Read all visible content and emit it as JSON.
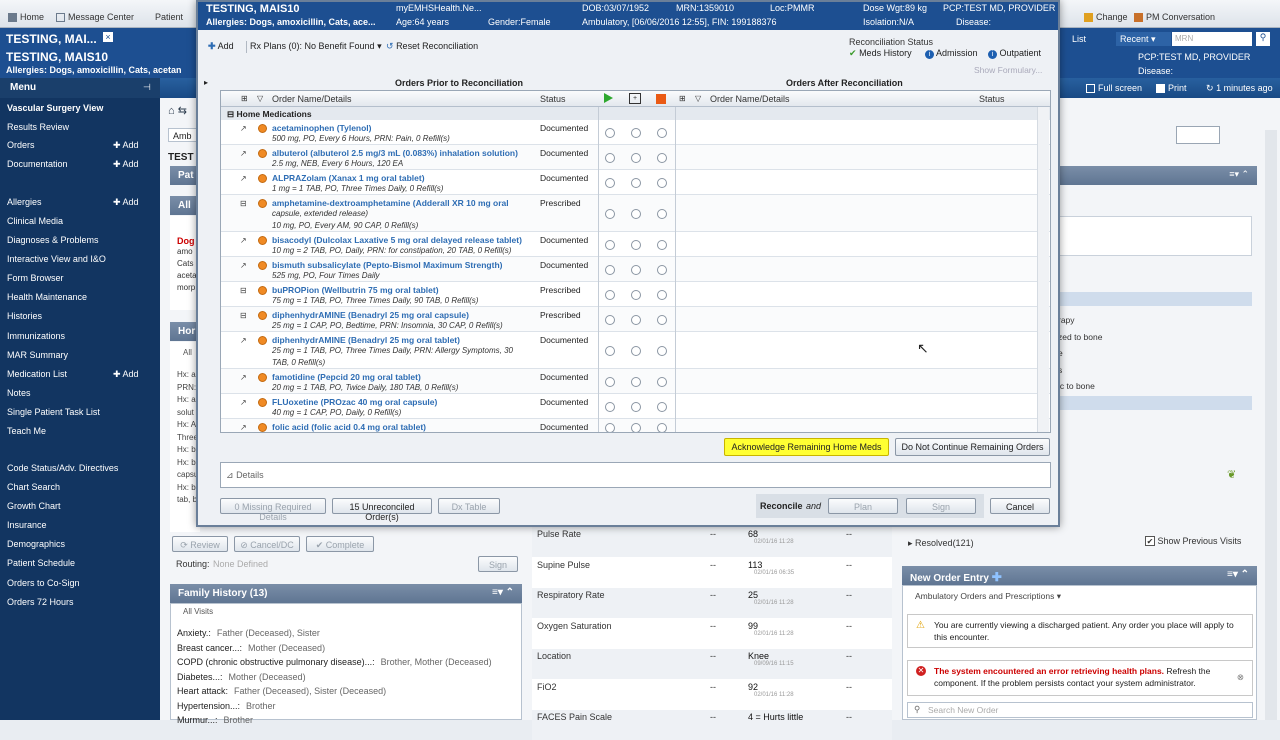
{
  "top_toolbar": {
    "home": "Home",
    "message_center": "Message Center",
    "patient": "Patient",
    "change": "Change",
    "pm_conversation": "PM Conversation",
    "list": "List",
    "recent": "Recent",
    "mrn_placeholder": "MRN"
  },
  "banner": {
    "name": "TESTING, MAI...",
    "name_full": "TESTING, MAIS10",
    "allergies": "Allergies: Dogs, amoxicillin, Cats, acetan",
    "pcp": "PCP:TEST MD, PROVIDER",
    "disease": "Disease:"
  },
  "strip": {
    "full_screen": "Full screen",
    "print": "Print",
    "updated": "1 minutes ago"
  },
  "menu": {
    "title": "Menu",
    "items": [
      {
        "label": "Vascular Surgery View",
        "add": ""
      },
      {
        "label": "Results Review",
        "add": ""
      },
      {
        "label": "Orders",
        "add": "Add"
      },
      {
        "label": "Documentation",
        "add": "Add"
      },
      {
        "label": "Allergies",
        "add": "Add"
      },
      {
        "label": "Clinical Media",
        "add": ""
      },
      {
        "label": "Diagnoses & Problems",
        "add": ""
      },
      {
        "label": "Interactive View and I&O",
        "add": ""
      },
      {
        "label": "Form Browser",
        "add": ""
      },
      {
        "label": "Health Maintenance",
        "add": ""
      },
      {
        "label": "Histories",
        "add": ""
      },
      {
        "label": "Immunizations",
        "add": ""
      },
      {
        "label": "MAR Summary",
        "add": ""
      },
      {
        "label": "Medication List",
        "add": "Add"
      },
      {
        "label": "Notes",
        "add": ""
      },
      {
        "label": "Single Patient Task List",
        "add": ""
      },
      {
        "label": "Teach Me",
        "add": ""
      },
      {
        "label": "Code Status/Adv. Directives",
        "add": ""
      },
      {
        "label": "Chart Search",
        "add": ""
      },
      {
        "label": "Growth Chart",
        "add": ""
      },
      {
        "label": "Insurance",
        "add": ""
      },
      {
        "label": "Demographics",
        "add": ""
      },
      {
        "label": "Patient Schedule",
        "add": ""
      },
      {
        "label": "Orders to Co-Sign",
        "add": ""
      },
      {
        "label": "Orders 72 Hours",
        "add": ""
      }
    ]
  },
  "background": {
    "amb": "Amb",
    "test": "TEST",
    "pat": "Pat",
    "all": "All",
    "allergy_dog": "Dog",
    "allergy_lines": [
      "amo",
      "Cats",
      "aceta",
      "morp"
    ],
    "hor": "Hor",
    "all2": "All",
    "left_frag": [
      "Hx: a",
      "PRN:",
      "Hx: a",
      "solut",
      "Hx: A",
      "Three",
      "Hx: b",
      "Hx: b",
      "capsu",
      "Hx: b",
      "tab, b"
    ],
    "review": "Review",
    "cancel_dc": "Cancel/DC",
    "complete": "Complete",
    "routing": "Routing:",
    "routing_val": "None Defined",
    "sign": "Sign",
    "family_history": {
      "title": "Family History",
      "count": "(13)",
      "all_visits": "All Visits",
      "rows": [
        {
          "cond": "Anxiety.:",
          "who": "Father (Deceased), Sister"
        },
        {
          "cond": "Breast cancer...:",
          "who": "Mother (Deceased)"
        },
        {
          "cond": "COPD (chronic obstructive pulmonary disease)...:",
          "who": "Brother, Mother (Deceased)"
        },
        {
          "cond": "Diabetes...:",
          "who": "Mother (Deceased)"
        },
        {
          "cond": "Heart attack:",
          "who": "Father (Deceased), Sister (Deceased)"
        },
        {
          "cond": "Hypertension...:",
          "who": "Brother"
        },
        {
          "cond": "Murmur...:",
          "who": "Brother"
        }
      ]
    },
    "vitals": [
      {
        "label": "Pulse Rate",
        "dash": "--",
        "val": "68",
        "date": "02/01/16 11:28",
        "dash2": "--"
      },
      {
        "label": "Supine Pulse",
        "dash": "--",
        "val": "113",
        "date": "02/01/16 06:35",
        "dash2": "--"
      },
      {
        "label": "Respiratory Rate",
        "dash": "--",
        "val": "25",
        "date": "02/01/16 11:28",
        "dash2": "--"
      },
      {
        "label": "Oxygen Saturation",
        "dash": "--",
        "val": "99",
        "date": "02/01/16 11:28",
        "dash2": "--"
      },
      {
        "label": "Location",
        "dash": "--",
        "val": "Knee",
        "date": "09/09/16 11:15",
        "dash2": "--"
      },
      {
        "label": "FiO2",
        "dash": "--",
        "val": "92",
        "date": "02/01/16 11:28",
        "dash2": "--"
      },
      {
        "label": "FACES Pain Scale",
        "dash": "--",
        "val": "4 = Hurts little",
        "date": "",
        "dash2": "--"
      }
    ],
    "right_frag": [
      "rapy",
      "zed to bone",
      "e",
      "s",
      "ic to bone"
    ],
    "resolved": "Resolved",
    "resolved_count": "(121)",
    "show_prev": "Show Previous Visits",
    "new_order": {
      "title": "New Order Entry",
      "sub": "Ambulatory Orders and Prescriptions",
      "warn": "You are currently viewing a discharged patient. Any order you place will apply to this encounter.",
      "err_bold": "The system encountered an error retrieving health plans.",
      "err_rest": " Refresh the component. If the problem persists contact your system administrator.",
      "search_ph": "Search New Order"
    }
  },
  "modal": {
    "name": "TESTING, MAIS10",
    "org": "myEMHSHealth.Ne...",
    "dob": "DOB:03/07/1952",
    "mrn": "MRN:1359010",
    "loc": "Loc:PMMR",
    "dose_wgt": "Dose Wgt:89 kg",
    "pcp": "PCP:TEST MD, PROVIDER",
    "allergies": "Allergies: Dogs, amoxicillin, Cats, ace...",
    "age": "Age:64 years",
    "gender": "Gender:Female",
    "encounter": "Ambulatory, [06/06/2016 12:55], FIN: 199188376",
    "isolation": "Isolation:N/A",
    "disease": "Disease:",
    "add": "Add",
    "rx_plans": "Rx Plans (0): No Benefit Found",
    "reset": "Reset Reconciliation",
    "recon_status": "Reconciliation Status",
    "meds_history": "Meds History",
    "admission": "Admission",
    "outpatient": "Outpatient",
    "show_formulary": "Show Formulary...",
    "prior_title": "Orders Prior to Reconciliation",
    "after_title": "Orders After Reconciliation",
    "col_name": "Order Name/Details",
    "col_status": "Status",
    "col_name2": "Order Name/Details",
    "col_status2": "Status",
    "group": "Home Medications",
    "orders": [
      {
        "name": "acetaminophen (Tylenol)",
        "detail": "500 mg, PO, Every 6 Hours, PRN: Pain, 0 Refill(s)",
        "detail2": "",
        "status": "Documented",
        "rx": false
      },
      {
        "name": "albuterol (albuterol 2.5 mg/3 mL (0.083%) inhalation solution)",
        "detail": "2.5 mg, NEB, Every 6 Hours, 120 EA",
        "detail2": "",
        "status": "Documented",
        "rx": false
      },
      {
        "name": "ALPRAZolam (Xanax 1 mg oral tablet)",
        "detail": "1 mg = 1 TAB, PO, Three Times Daily, 0 Refill(s)",
        "detail2": "",
        "status": "Documented",
        "rx": false
      },
      {
        "name": "amphetamine-dextroamphetamine (Adderall XR 10 mg oral",
        "detail": "capsule, extended release)",
        "detail2": "10 mg, PO, Every AM, 90 CAP, 0 Refill(s)",
        "status": "Prescribed",
        "rx": true
      },
      {
        "name": "bisacodyl (Dulcolax Laxative 5 mg oral delayed release tablet)",
        "detail": "10 mg = 2 TAB, PO, Daily, PRN: for constipation, 20 TAB, 0 Refill(s)",
        "detail2": "",
        "status": "Documented",
        "rx": false
      },
      {
        "name": "bismuth subsalicylate (Pepto-Bismol Maximum Strength)",
        "detail": "525 mg, PO, Four Times Daily",
        "detail2": "",
        "status": "Documented",
        "rx": false
      },
      {
        "name": "buPROPion (Wellbutrin 75 mg oral tablet)",
        "detail": "75 mg = 1 TAB, PO, Three Times Daily, 90 TAB, 0 Refill(s)",
        "detail2": "",
        "status": "Prescribed",
        "rx": true
      },
      {
        "name": "diphenhydrAMINE (Benadryl 25 mg oral capsule)",
        "detail": "25 mg = 1 CAP, PO, Bedtime, PRN: Insomnia, 30 CAP, 0 Refill(s)",
        "detail2": "",
        "status": "Prescribed",
        "rx": true
      },
      {
        "name": "diphenhydrAMINE (Benadryl 25 mg oral tablet)",
        "detail": "25 mg = 1 TAB, PO, Three Times Daily, PRN: Allergy Symptoms, 30",
        "detail2": "TAB, 0 Refill(s)",
        "status": "Documented",
        "rx": false
      },
      {
        "name": "famotidine (Pepcid 20 mg oral tablet)",
        "detail": "20 mg = 1 TAB, PO, Twice Daily, 180 TAB, 0 Refill(s)",
        "detail2": "",
        "status": "Documented",
        "rx": false
      },
      {
        "name": "FLUoxetine (PROzac 40 mg oral capsule)",
        "detail": "40 mg = 1 CAP, PO, Daily, 0 Refill(s)",
        "detail2": "",
        "status": "Documented",
        "rx": false
      },
      {
        "name": "folic acid (folic acid 0.4 mg oral tablet)",
        "detail": "",
        "detail2": "",
        "status": "Documented",
        "rx": false
      }
    ],
    "ack": "Acknowledge Remaining Home Meds",
    "dnc": "Do Not Continue Remaining Orders",
    "details": "Details",
    "missing": "0 Missing Required Details",
    "unreconciled": "15 Unreconciled Order(s)",
    "dx_table": "Dx Table",
    "reconcile": "Reconcile",
    "and": "and",
    "plan": "Plan",
    "sign": "Sign",
    "cancel": "Cancel"
  },
  "colors": {
    "banner": "#1d4f91",
    "menu": "#123561",
    "link": "#2e6db4",
    "ack_bg": "#ffff33",
    "pill": "#f08a24"
  }
}
